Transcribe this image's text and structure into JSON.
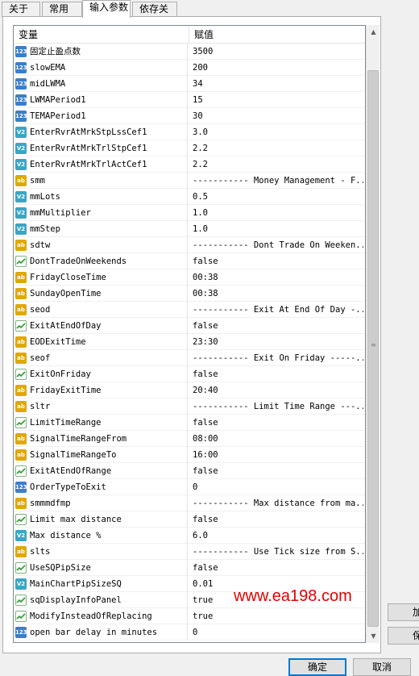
{
  "tabs": [
    {
      "label": "关于"
    },
    {
      "label": "常用"
    },
    {
      "label": "输入参数"
    },
    {
      "label": "依存关系"
    }
  ],
  "grid": {
    "col_variable": "变量",
    "col_value": "赋值",
    "rows": [
      {
        "type": "int",
        "name": "固定止盈点数",
        "value": "3500"
      },
      {
        "type": "int",
        "name": "slowEMA",
        "value": "200"
      },
      {
        "type": "int",
        "name": "midLWMA",
        "value": "34"
      },
      {
        "type": "int",
        "name": "LWMAPeriod1",
        "value": "15"
      },
      {
        "type": "int",
        "name": "TEMAPeriod1",
        "value": "30"
      },
      {
        "type": "dbl",
        "name": "EnterRvrAtMrkStpLssCef1",
        "value": "3.0"
      },
      {
        "type": "dbl",
        "name": "EnterRvrAtMrkTrlStpCef1",
        "value": "2.2"
      },
      {
        "type": "dbl",
        "name": "EnterRvrAtMrkTrlActCef1",
        "value": "2.2"
      },
      {
        "type": "str",
        "name": "smm",
        "value": "----------- Money Management - F..."
      },
      {
        "type": "dbl",
        "name": "mmLots",
        "value": "0.5"
      },
      {
        "type": "dbl",
        "name": "mmMultiplier",
        "value": "1.0"
      },
      {
        "type": "dbl",
        "name": "mmStep",
        "value": "1.0"
      },
      {
        "type": "str",
        "name": "sdtw",
        "value": "----------- Dont Trade On Weeken..."
      },
      {
        "type": "bool",
        "name": "DontTradeOnWeekends",
        "value": "false"
      },
      {
        "type": "str",
        "name": "FridayCloseTime",
        "value": "00:38"
      },
      {
        "type": "str",
        "name": "SundayOpenTime",
        "value": "00:38"
      },
      {
        "type": "str",
        "name": "seod",
        "value": "----------- Exit At End Of Day -..."
      },
      {
        "type": "bool",
        "name": "ExitAtEndOfDay",
        "value": "false"
      },
      {
        "type": "str",
        "name": "EODExitTime",
        "value": "23:30"
      },
      {
        "type": "str",
        "name": "seof",
        "value": "----------- Exit On Friday -----..."
      },
      {
        "type": "bool",
        "name": "ExitOnFriday",
        "value": "false"
      },
      {
        "type": "str",
        "name": "FridayExitTime",
        "value": "20:40"
      },
      {
        "type": "str",
        "name": "sltr",
        "value": "----------- Limit Time Range ---..."
      },
      {
        "type": "bool",
        "name": "LimitTimeRange",
        "value": "false"
      },
      {
        "type": "str",
        "name": "SignalTimeRangeFrom",
        "value": "08:00"
      },
      {
        "type": "str",
        "name": "SignalTimeRangeTo",
        "value": "16:00"
      },
      {
        "type": "bool",
        "name": "ExitAtEndOfRange",
        "value": "false"
      },
      {
        "type": "int",
        "name": "OrderTypeToExit",
        "value": "0"
      },
      {
        "type": "str",
        "name": "smmmdfmp",
        "value": "----------- Max distance from ma..."
      },
      {
        "type": "bool",
        "name": "Limit max distance",
        "value": "false"
      },
      {
        "type": "dbl",
        "name": "Max distance %",
        "value": "6.0"
      },
      {
        "type": "str",
        "name": "slts",
        "value": "----------- Use Tick size from S..."
      },
      {
        "type": "bool",
        "name": "UseSQPipSize",
        "value": "false"
      },
      {
        "type": "dbl",
        "name": "MainChartPipSizeSQ",
        "value": "0.01"
      },
      {
        "type": "bool",
        "name": "sqDisplayInfoPanel",
        "value": "true"
      },
      {
        "type": "bool",
        "name": "ModifyInsteadOfReplacing",
        "value": "true"
      },
      {
        "type": "int",
        "name": "open bar delay in minutes",
        "value": "0"
      }
    ]
  },
  "icon_labels": {
    "int": "123",
    "dbl": "V2",
    "str": "ab"
  },
  "side_buttons": {
    "load": "加",
    "save": "保"
  },
  "footer": {
    "ok": "确定",
    "cancel": "取消"
  },
  "watermark": "www.ea198.com",
  "colors": {
    "watermark": "#e40000",
    "accent": "#0078d7"
  }
}
